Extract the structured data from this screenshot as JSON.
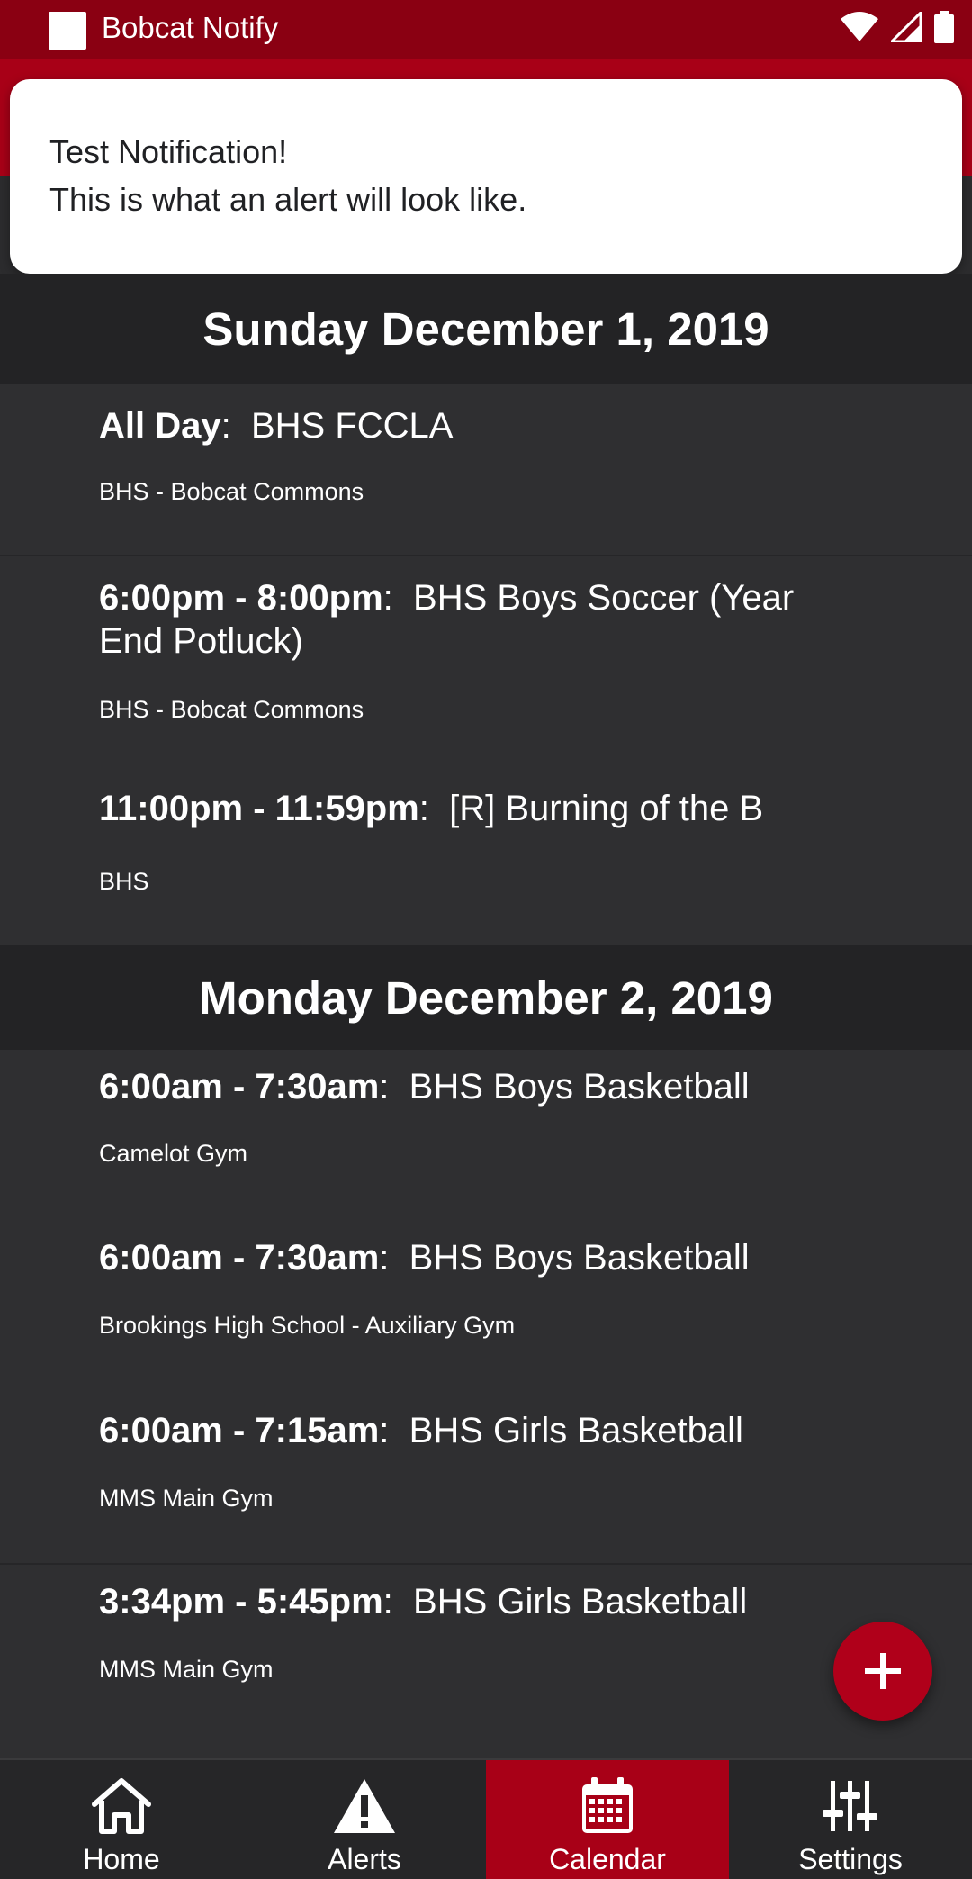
{
  "status_bar": {
    "app_name": "Bobcat Notify"
  },
  "notification": {
    "title": "Test Notification!",
    "body": "This is what an alert will look like."
  },
  "days": [
    {
      "header": "Sunday December 1, 2019",
      "events": [
        {
          "time": "All Day",
          "title": "BHS FCCLA",
          "location": "BHS - Bobcat Commons"
        },
        {
          "time": "6:00pm - 8:00pm",
          "title": "BHS Boys Soccer (Year End Potluck)",
          "location": "BHS - Bobcat Commons"
        },
        {
          "time": "11:00pm - 11:59pm",
          "title": "[R] Burning of the B",
          "location": "BHS"
        }
      ]
    },
    {
      "header": "Monday December 2, 2019",
      "events": [
        {
          "time": "6:00am - 7:30am",
          "title": "BHS Boys Basketball",
          "location": "Camelot Gym"
        },
        {
          "time": "6:00am - 7:30am",
          "title": "BHS Boys Basketball",
          "location": "Brookings High School - Auxiliary Gym"
        },
        {
          "time": "6:00am - 7:15am",
          "title": "BHS Girls Basketball",
          "location": "MMS Main Gym"
        },
        {
          "time": "3:34pm - 5:45pm",
          "title": "BHS Girls Basketball",
          "location": "MMS Main Gym"
        }
      ]
    }
  ],
  "separator": ":",
  "fab_icon": "plus-icon",
  "bottom_nav": [
    {
      "label": "Home",
      "icon": "home-icon",
      "active": false
    },
    {
      "label": "Alerts",
      "icon": "alert-triangle-icon",
      "active": false
    },
    {
      "label": "Calendar",
      "icon": "calendar-icon",
      "active": true
    },
    {
      "label": "Settings",
      "icon": "sliders-icon",
      "active": false
    }
  ],
  "colors": {
    "status_bar": "#8a0012",
    "accent": "#a80017",
    "background": "#2c2c2e",
    "day_header": "#232325"
  }
}
